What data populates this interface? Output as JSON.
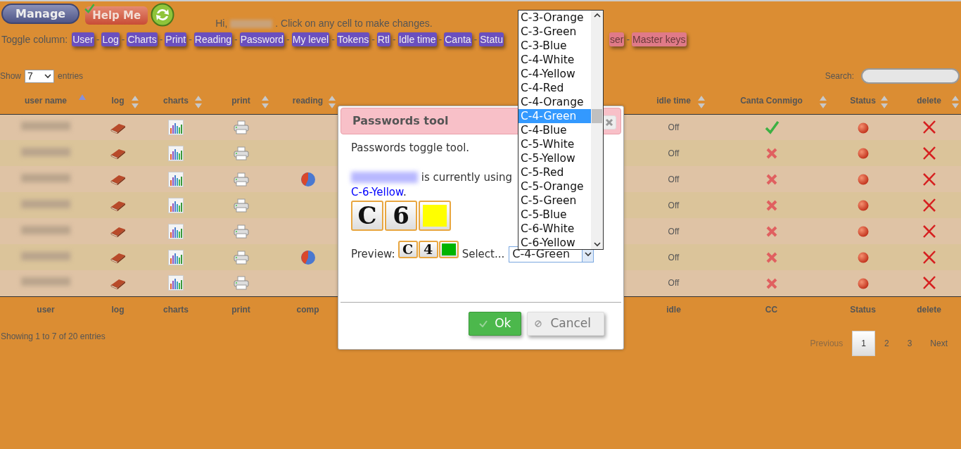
{
  "toolbar": {
    "manage_button": "Manage",
    "help_button": "Help Me"
  },
  "greeting": {
    "prefix": "Hi,",
    "suffix": ". Click on any cell to make changes."
  },
  "toggle_column": {
    "label": "Toggle column:",
    "items": [
      {
        "label": "User",
        "on": true
      },
      {
        "prefix": "-",
        "label": "Log",
        "on": true
      },
      {
        "prefix": "-",
        "label": "Charts",
        "on": true
      },
      {
        "prefix": "-",
        "label": "Print",
        "on": true
      },
      {
        "prefix": "-",
        "label": "Reading",
        "on": true
      },
      {
        "prefix": "-",
        "label": "Password",
        "on": true
      },
      {
        "prefix": "-",
        "label": "My level",
        "on": true
      },
      {
        "prefix": "-",
        "label": "Tokens",
        "on": true
      },
      {
        "prefix": "-",
        "label": "Rtl",
        "on": true
      },
      {
        "prefix": "-",
        "label": "Idle time",
        "on": true
      },
      {
        "prefix": "-",
        "label": "Canta",
        "on": true
      },
      {
        "prefix": "-",
        "label": "Statu",
        "on": true
      },
      {
        "label": "ser",
        "on": false
      },
      {
        "prefix": "-",
        "label": "Master keys",
        "on": false
      }
    ]
  },
  "length": {
    "label_before": "Show",
    "value": "7",
    "label_after": "entries"
  },
  "search": {
    "label": "Search:"
  },
  "table": {
    "columns": [
      {
        "label": "user name",
        "sorted": true
      },
      {
        "label": "log",
        "sorted": false
      },
      {
        "label": "charts",
        "sorted": false
      },
      {
        "label": "print",
        "sorted": false
      },
      {
        "label": "reading",
        "sorted": false
      },
      {
        "label": "idle time",
        "sorted": false
      },
      {
        "label": "Canta Conmigo",
        "sorted": false
      },
      {
        "label": "Status",
        "sorted": false
      },
      {
        "label": "delete",
        "sorted": false
      }
    ],
    "rows": [
      {
        "reading": false,
        "idle_time": "Off",
        "canta_conmigo": true
      },
      {
        "reading": false,
        "idle_time": "Off",
        "canta_conmigo": false
      },
      {
        "reading": true,
        "idle_time": "Off",
        "canta_conmigo": false
      },
      {
        "reading": false,
        "idle_time": "Off",
        "canta_conmigo": false
      },
      {
        "reading": false,
        "idle_time": "Off",
        "canta_conmigo": false
      },
      {
        "reading": true,
        "idle_time": "Off",
        "canta_conmigo": false
      },
      {
        "reading": false,
        "idle_time": "Off",
        "canta_conmigo": false
      }
    ],
    "footer": [
      "user",
      "log",
      "charts",
      "print",
      "comp",
      "idle",
      "CC",
      "Status",
      "delete"
    ]
  },
  "info": "Showing 1 to 7 of 20 entries",
  "pagination": {
    "previous": {
      "label": "Previous",
      "disabled": true
    },
    "pages": [
      {
        "label": "1",
        "selected": true
      },
      {
        "label": "2",
        "selected": false
      },
      {
        "label": "3",
        "selected": false
      }
    ],
    "next": {
      "label": "Next",
      "disabled": false
    }
  },
  "modal": {
    "title": "Passwords tool",
    "intro": "Passwords toggle tool.",
    "current_text": "is currently using",
    "current_value": "C-6-Yellow",
    "current_end": ".",
    "current_tiles": [
      {
        "kind": "letter",
        "text": "C"
      },
      {
        "kind": "letter",
        "text": "6"
      },
      {
        "kind": "swatch",
        "color": "#ffff00"
      }
    ],
    "preview_label": "Preview:",
    "preview_tiles": [
      {
        "kind": "letter",
        "text": "C"
      },
      {
        "kind": "letter",
        "text": "4"
      },
      {
        "kind": "swatch",
        "color": "#00b400"
      }
    ],
    "select_label": "Select...",
    "select_value": "C-4-Green",
    "options": [
      {
        "label": "C-3-Orange",
        "selected": false
      },
      {
        "label": "C-3-Green",
        "selected": false
      },
      {
        "label": "C-3-Blue",
        "selected": false
      },
      {
        "label": "C-4-White",
        "selected": false
      },
      {
        "label": "C-4-Yellow",
        "selected": false
      },
      {
        "label": "C-4-Red",
        "selected": false
      },
      {
        "label": "C-4-Orange",
        "selected": false
      },
      {
        "label": "C-4-Green",
        "selected": true
      },
      {
        "label": "C-4-Blue",
        "selected": false
      },
      {
        "label": "C-5-White",
        "selected": false
      },
      {
        "label": "C-5-Yellow",
        "selected": false
      },
      {
        "label": "C-5-Red",
        "selected": false
      },
      {
        "label": "C-5-Orange",
        "selected": false
      },
      {
        "label": "C-5-Green",
        "selected": false
      },
      {
        "label": "C-5-Blue",
        "selected": false
      },
      {
        "label": "C-6-White",
        "selected": false
      },
      {
        "label": "C-6-Yellow",
        "selected": false
      }
    ],
    "ok_button": "Ok",
    "cancel_button": "Cancel"
  }
}
